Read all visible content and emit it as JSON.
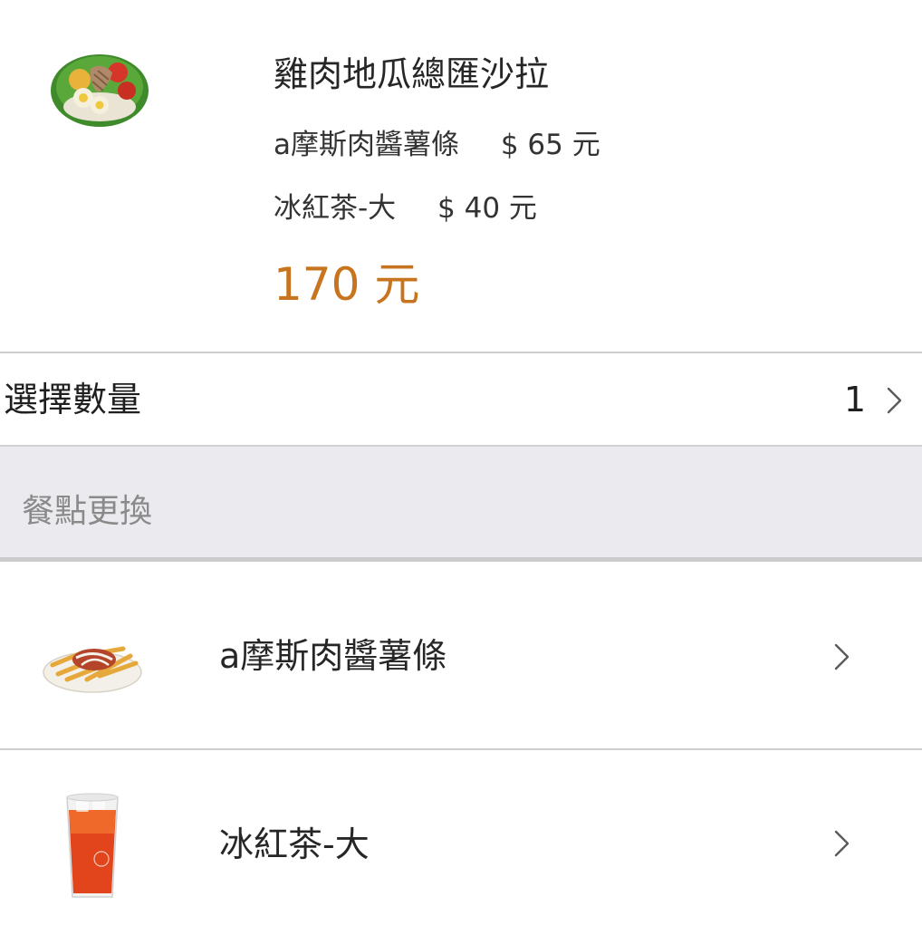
{
  "product": {
    "thumb_icon": "salad-image",
    "title": "雞肉地瓜總匯沙拉",
    "addons": [
      {
        "name": "a摩斯肉醬薯條",
        "price": "$ 65 元"
      },
      {
        "name": "冰紅茶-大",
        "price": "$ 40 元"
      }
    ],
    "total": "170 元",
    "total_color": "#c8731e"
  },
  "quantity": {
    "label": "選擇數量",
    "value": "1",
    "chevron_icon": "chevron-right-icon"
  },
  "swap_section": {
    "title": "餐點更換",
    "items": [
      {
        "label": "a摩斯肉醬薯條",
        "thumb_icon": "fries-image",
        "chevron_icon": "chevron-right-icon"
      },
      {
        "label": "冰紅茶-大",
        "thumb_icon": "iced-tea-image",
        "chevron_icon": "chevron-right-icon"
      }
    ]
  }
}
